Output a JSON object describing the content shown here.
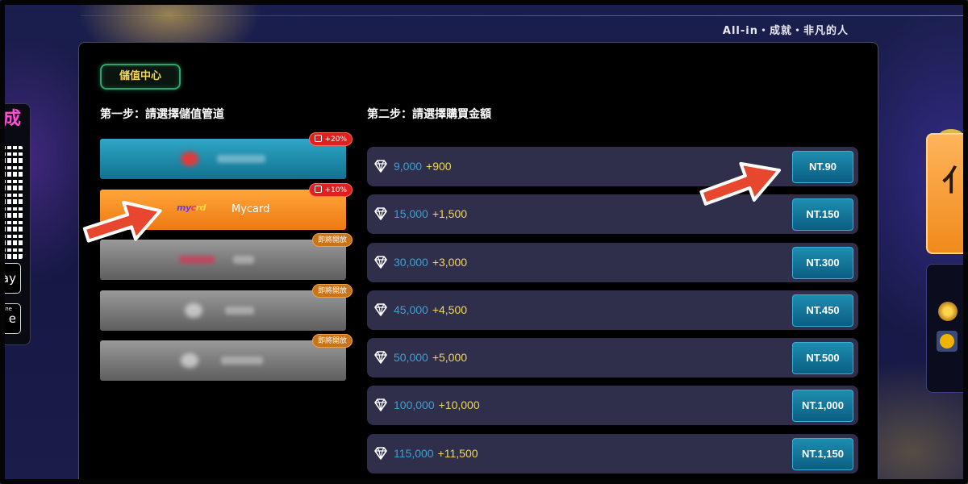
{
  "header": {
    "slogan": "All-in・成就・非凡的人"
  },
  "left_widget": {
    "store_1": "ay",
    "store_2_small": "ne",
    "store_2": "e"
  },
  "panel": {
    "title": "儲值中心",
    "step1_title": "第一步：請選擇儲值管道",
    "step2_title": "第二步：請選擇購買金額"
  },
  "channels": [
    {
      "label": "",
      "tag": "+20%",
      "style": "teal"
    },
    {
      "label": "Mycard",
      "tag": "+10%",
      "style": "orange",
      "logo": [
        "my",
        "c",
        "rd"
      ]
    },
    {
      "label": "",
      "tag": "即將開放",
      "style": "gray"
    },
    {
      "label": "",
      "tag": "即將開放",
      "style": "gray"
    },
    {
      "label": "",
      "tag": "即將開放",
      "style": "gray"
    }
  ],
  "amounts": [
    {
      "base": "9,000",
      "bonus": "+900",
      "price": "NT.90"
    },
    {
      "base": "15,000",
      "bonus": "+1,500",
      "price": "NT.150"
    },
    {
      "base": "30,000",
      "bonus": "+3,000",
      "price": "NT.300"
    },
    {
      "base": "45,000",
      "bonus": "+4,500",
      "price": "NT.450"
    },
    {
      "base": "50,000",
      "bonus": "+5,000",
      "price": "NT.500"
    },
    {
      "base": "100,000",
      "bonus": "+10,000",
      "price": "NT.1,000"
    },
    {
      "base": "115,000",
      "bonus": "+11,500",
      "price": "NT.1,150"
    }
  ],
  "colors": {
    "accent_gold": "#f3d65a",
    "amount_blue": "#3f9fd2",
    "price_button": "#0b5e82",
    "tag_red": "#e0201e",
    "tag_amber": "#c8741b",
    "arrow": "#e8472f"
  }
}
